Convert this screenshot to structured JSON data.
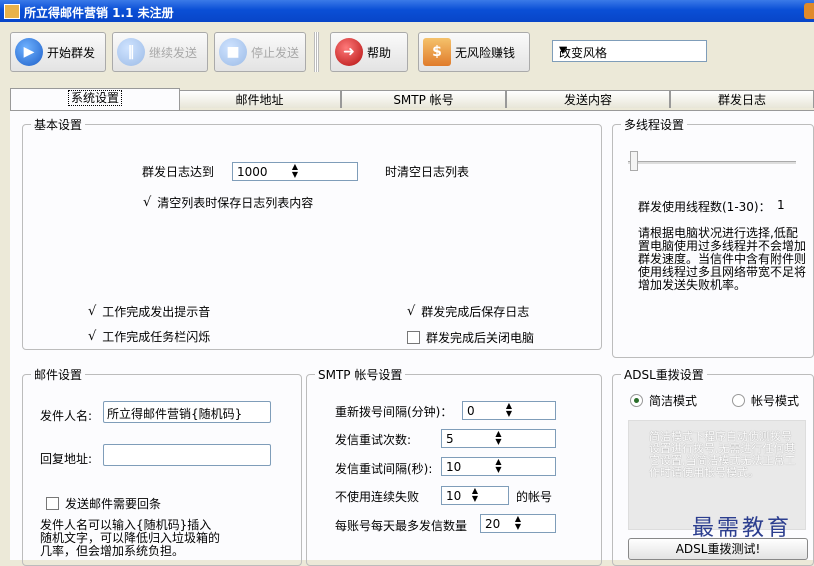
{
  "window": {
    "title": "所立得邮件营销 1.1  未注册"
  },
  "toolbar": {
    "start": "开始群发",
    "resume": "继续发送",
    "stop": "停止发送",
    "help": "帮助",
    "norisk": "无风险赚钱",
    "style_select": "改变风格"
  },
  "tabs": [
    "系统设置",
    "邮件地址",
    "SMTP 帐号",
    "发送内容",
    "群发日志"
  ],
  "basic": {
    "legend": "基本设置",
    "log_limit_label": "群发日志达到",
    "log_limit_value": "1000",
    "log_limit_suffix": "时清空日志列表",
    "save_log_on_clear": "清空列表时保存日志列表内容",
    "notify_sound": "工作完成发出提示音",
    "save_log_after": "群发完成后保存日志",
    "flash_taskbar": "工作完成任务栏闪烁",
    "shutdown_after": "群发完成后关闭电脑"
  },
  "checks": {
    "save_log_on_clear": true,
    "notify_sound": true,
    "save_log_after": true,
    "flash_taskbar": true,
    "shutdown_after": false,
    "need_reply": false
  },
  "thread": {
    "legend": "多线程设置",
    "count_label": "群发使用线程数(1-30)：",
    "count_value": "1",
    "note": "请根据电脑状况进行选择,低配置电脑使用过多线程并不会增加群发速度。当信件中含有附件则使用线程过多且网络带宽不足将增加发送失败机率。"
  },
  "mail": {
    "legend": "邮件设置",
    "sender_label": "发件人名:",
    "sender_value": "所立得邮件营销{随机码}",
    "reply_label": "回复地址:",
    "reply_value": "",
    "need_reply": "发送邮件需要回条",
    "tip": "发件人名可以输入{随机码}插入随机文字，可以降低归入垃圾箱的几率，但会增加系统负担。"
  },
  "smtp": {
    "legend": "SMTP 帐号设置",
    "redial_label": "重新拨号间隔(分钟)：",
    "redial_value": "0",
    "retry_label": "发信重试次数:",
    "retry_value": "5",
    "retry_interval_label": "发信重试间隔(秒):",
    "retry_interval_value": "10",
    "disable_label": "不使用连续失败",
    "disable_value": "10",
    "disable_suffix": "的帐号",
    "max_label": "每账号每天最多发信数量",
    "max_value": "20"
  },
  "adsl": {
    "legend": "ADSL重拨设置",
    "mode_simple": "简洁模式",
    "mode_account": "帐号模式",
    "note": "简洁模式下程序自动侦测拨号设置进行拨号,无需进行任何其它设置,当简洁模式无法正常工作时请使用帐号模式。",
    "test_button": "ADSL重拨测试!"
  },
  "watermark": "最需教育",
  "colors": {
    "titlebar": "#0a4fd6",
    "accent_blue": "#2f7ae5",
    "help_red": "#c81e1e"
  }
}
